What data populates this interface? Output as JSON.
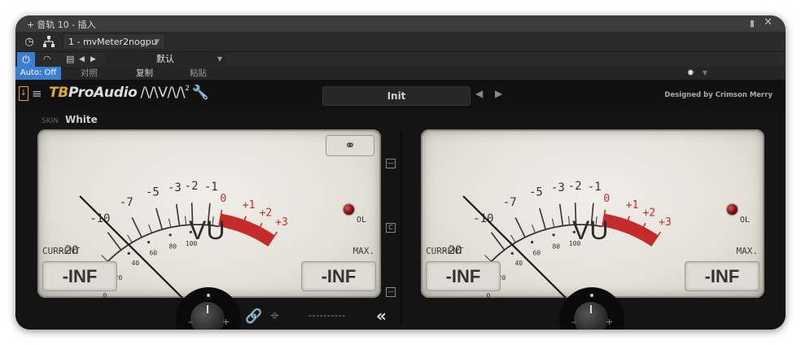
{
  "titlebar": {
    "title": "音轨 10 - 插入",
    "plus": "+",
    "pin": "📌",
    "close": "✕"
  },
  "toolbar1": {
    "preset": "1 - mvMeter2nogpu"
  },
  "toolbar2": {
    "default_preset": "默认"
  },
  "toolbar3": {
    "auto": "Auto: Off",
    "compare": "对照",
    "copy": "复制",
    "paste": "粘贴"
  },
  "plugin": {
    "brand_tb": "TB",
    "brand_name": "ProAudio",
    "brand_mv": "/\\/\\V/\\/\\",
    "brand_sup": "2",
    "preset_name": "Init",
    "designed_by": "Designed by Crimson Merry",
    "skin_label": "SKIN",
    "skin_value": "White",
    "mid_buttons": [
      "—",
      "C",
      "—"
    ],
    "sync_placeholder": "----------",
    "collapse": "«",
    "knob_minus": "–",
    "knob_plus": "+"
  },
  "meters": [
    {
      "scale_top": [
        "-20",
        "-10",
        "-7",
        "-5",
        "-3",
        "-2",
        "-1",
        "0",
        "+1",
        "+2",
        "+3"
      ],
      "scale_bottom": [
        "0",
        "20",
        "40",
        "60",
        "80",
        "100"
      ],
      "unit": "VU",
      "ol_label": "OL",
      "current_label": "CURRENT",
      "current_value": "-INF",
      "max_label": "MAX.",
      "max_value": "-INF"
    },
    {
      "scale_top": [
        "-20",
        "-10",
        "-7",
        "-5",
        "-3",
        "-2",
        "-1",
        "0",
        "+1",
        "+2",
        "+3"
      ],
      "scale_bottom": [
        "0",
        "20",
        "40",
        "60",
        "80",
        "100"
      ],
      "unit": "VU",
      "ol_label": "OL",
      "current_label": "CURRENT",
      "current_value": "-INF",
      "max_label": "MAX.",
      "max_value": "-INF"
    }
  ],
  "colors": {
    "accent_blue": "#3a7fd0",
    "brand_gold": "#e3a92c",
    "redzone": "#c62b2b"
  }
}
